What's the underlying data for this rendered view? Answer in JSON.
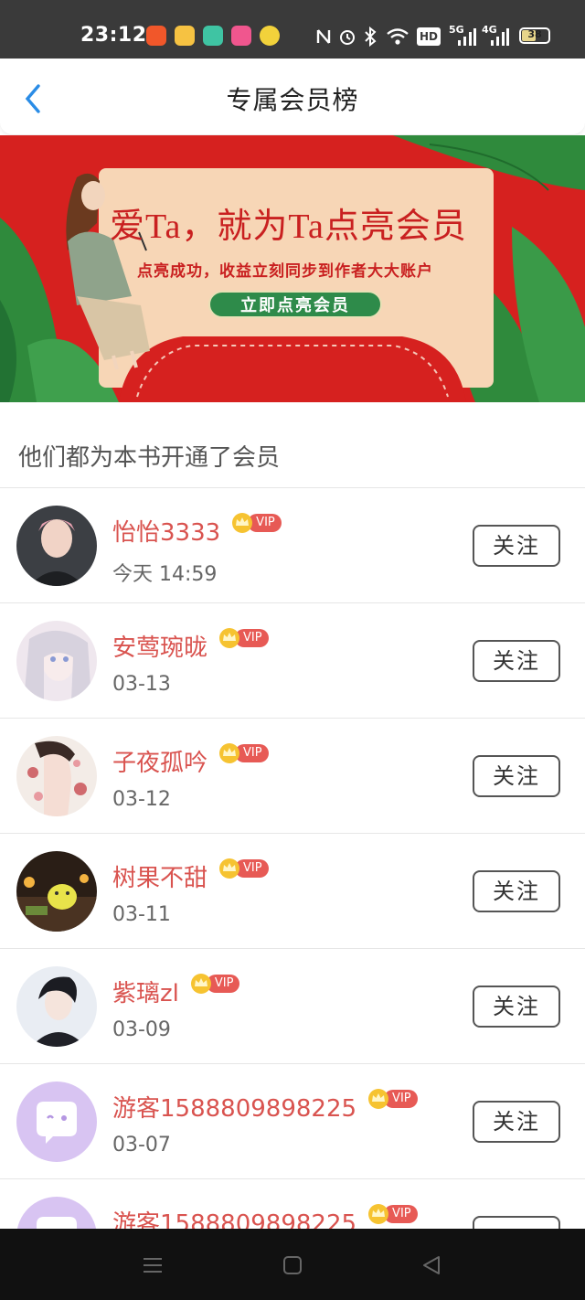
{
  "status_bar": {
    "time": "23:12",
    "hd_label": "HD",
    "net1": "5G",
    "net2": "4G",
    "battery": "38",
    "app_icons": [
      "taobao-icon",
      "weibo-icon",
      "notes-icon",
      "bilibili-icon",
      "chat-icon"
    ],
    "system_icons": [
      "nfc-icon",
      "alarm-icon",
      "bluetooth-icon",
      "wifi-icon",
      "hd-icon",
      "signal-5g-icon",
      "signal-4g-icon",
      "battery-icon"
    ]
  },
  "nav": {
    "title": "专属会员榜",
    "back_icon": "chevron-left-icon"
  },
  "banner": {
    "headline": "爱Ta，就为Ta点亮会员",
    "subtitle": "点亮成功，收益立刻同步到作者大大账户",
    "cta": "立即点亮会员"
  },
  "section": {
    "title": "他们都为本书开通了会员"
  },
  "members": [
    {
      "name": "怡怡3333",
      "vip": "VIP",
      "time": "今天 14:59",
      "follow": "关注"
    },
    {
      "name": "安莺琬昽",
      "vip": "VIP",
      "time": "03-13",
      "follow": "关注"
    },
    {
      "name": "子夜孤吟",
      "vip": "VIP",
      "time": "03-12",
      "follow": "关注"
    },
    {
      "name": "树果不甜",
      "vip": "VIP",
      "time": "03-11",
      "follow": "关注"
    },
    {
      "name": "紫璃zl",
      "vip": "VIP",
      "time": "03-09",
      "follow": "关注"
    },
    {
      "name": "游客1588809898225",
      "vip": "VIP",
      "time": "03-07",
      "follow": "关注"
    },
    {
      "name": "游客1588809898225",
      "vip": "VIP",
      "time": "",
      "follow": ""
    }
  ],
  "bottom_nav": {
    "icons": [
      "menu-icon",
      "home-square-icon",
      "back-triangle-icon"
    ]
  },
  "colors": {
    "accent_name": "#d9534f",
    "vip_badge": "#e75a55",
    "banner_red": "#d6211f",
    "cta_green": "#2e8b4a",
    "nav_blue": "#2a8ce6"
  }
}
